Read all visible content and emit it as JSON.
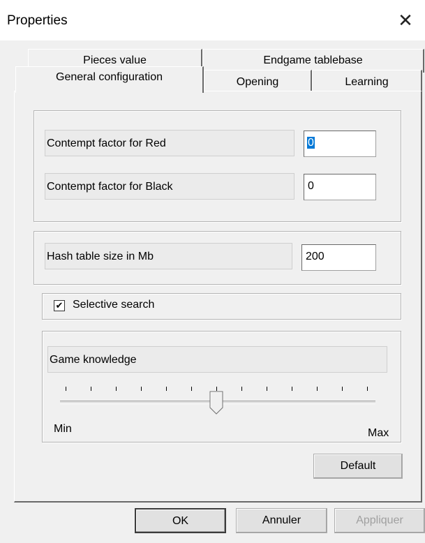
{
  "window": {
    "title": "Properties",
    "close_glyph": "✕"
  },
  "tabs": {
    "row_back": [
      {
        "label": "Pieces value"
      },
      {
        "label": "Endgame tablebase"
      }
    ],
    "row_front": [
      {
        "label": "General configuration",
        "selected": true
      },
      {
        "label": "Opening"
      },
      {
        "label": "Learning"
      }
    ]
  },
  "contempt": {
    "red_label": "Contempt factor for Red",
    "red_value": "0",
    "black_label": "Contempt factor for Black",
    "black_value": "0"
  },
  "hash": {
    "label": "Hash table size in Mb",
    "value": "200"
  },
  "selective_search": {
    "label": "Selective search",
    "checked": true,
    "check_glyph": "✔"
  },
  "knowledge": {
    "label": "Game knowledge",
    "min_label": "Min",
    "max_label": "Max",
    "tick_count": 13,
    "slider_fraction": 0.5
  },
  "buttons": {
    "default": "Default",
    "ok": "OK",
    "cancel": "Annuler",
    "apply": "Appliquer"
  },
  "colors": {
    "selection": "#0078d7",
    "window_bg": "#f0f0f0",
    "disabled_text": "#a0a0a0"
  }
}
